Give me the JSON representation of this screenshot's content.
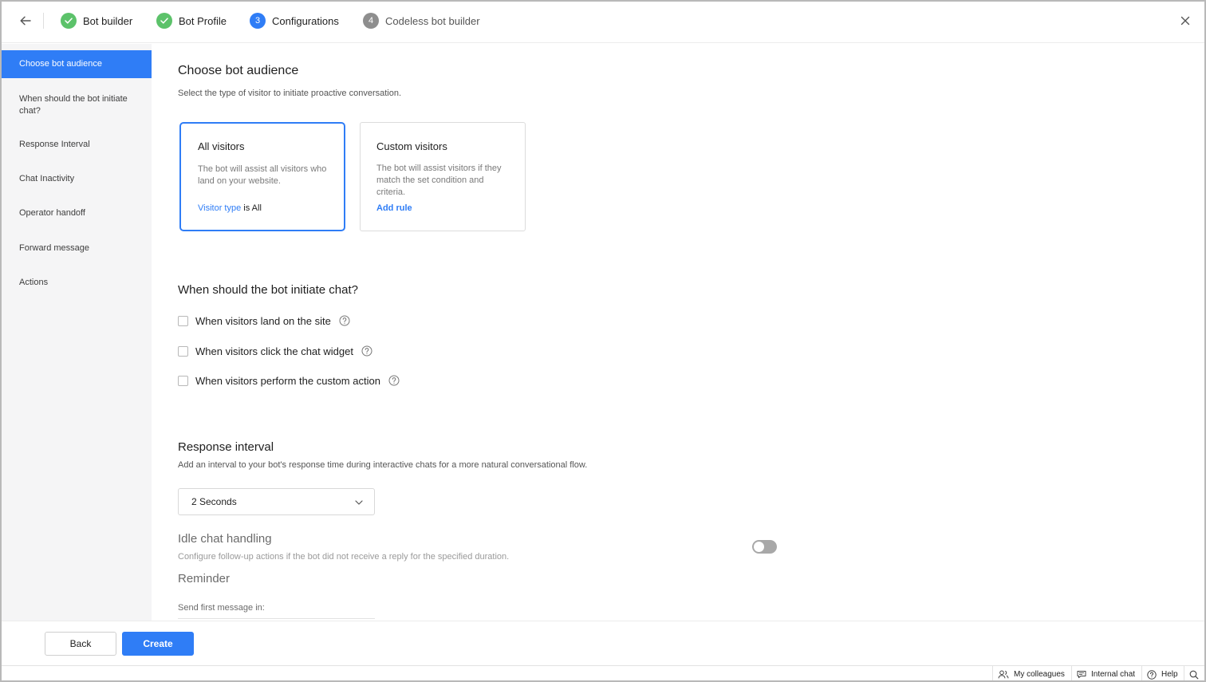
{
  "stepper": {
    "steps": [
      {
        "label": "Bot builder",
        "status": "done",
        "marker": "check-icon"
      },
      {
        "label": "Bot Profile",
        "status": "done",
        "marker": "check-icon"
      },
      {
        "label": "Configurations",
        "status": "active",
        "marker": "3"
      },
      {
        "label": "Codeless bot builder",
        "status": "todo",
        "marker": "4"
      }
    ]
  },
  "sidebar": {
    "items": [
      {
        "label": "Choose bot audience",
        "active": true
      },
      {
        "label": "When should the bot initiate chat?",
        "active": false
      },
      {
        "label": "Response Interval",
        "active": false
      },
      {
        "label": "Chat Inactivity",
        "active": false
      },
      {
        "label": "Operator handoff",
        "active": false
      },
      {
        "label": "Forward message",
        "active": false
      },
      {
        "label": "Actions",
        "active": false
      }
    ]
  },
  "audience": {
    "title": "Choose bot audience",
    "subtitle": "Select the type of visitor to initiate proactive conversation.",
    "cards": [
      {
        "title": "All visitors",
        "description": "The bot will assist all visitors who land on your website.",
        "rule_link": "Visitor type",
        "rule_text": " is All",
        "selected": true
      },
      {
        "title": "Custom visitors",
        "description": "The bot will assist visitors if they match the set condition and criteria.",
        "action_link": "Add rule",
        "selected": false
      }
    ]
  },
  "initiate": {
    "title": "When should the bot initiate chat?",
    "options": [
      {
        "label": "When visitors land on the site",
        "checked": false
      },
      {
        "label": "When visitors click the chat widget",
        "checked": false
      },
      {
        "label": "When visitors perform the custom action",
        "checked": false
      }
    ]
  },
  "response_interval": {
    "title": "Response interval",
    "subtitle": "Add an interval to your bot's response time during interactive chats for a more natural conversational flow.",
    "selected": "2 Seconds"
  },
  "idle": {
    "title": "Idle chat handling",
    "subtitle": "Configure follow-up actions if the bot did not receive a reply for the specified duration.",
    "enabled": false,
    "reminder_title": "Reminder",
    "send_first_label": "Send first message in:"
  },
  "footer": {
    "back_label": "Back",
    "create_label": "Create"
  },
  "statusbar": {
    "colleagues": "My colleagues",
    "internal_chat": "Internal chat",
    "help": "Help"
  },
  "colors": {
    "accent": "#2f7df6",
    "done": "#5cc26a",
    "todo": "#8e8e8e"
  }
}
